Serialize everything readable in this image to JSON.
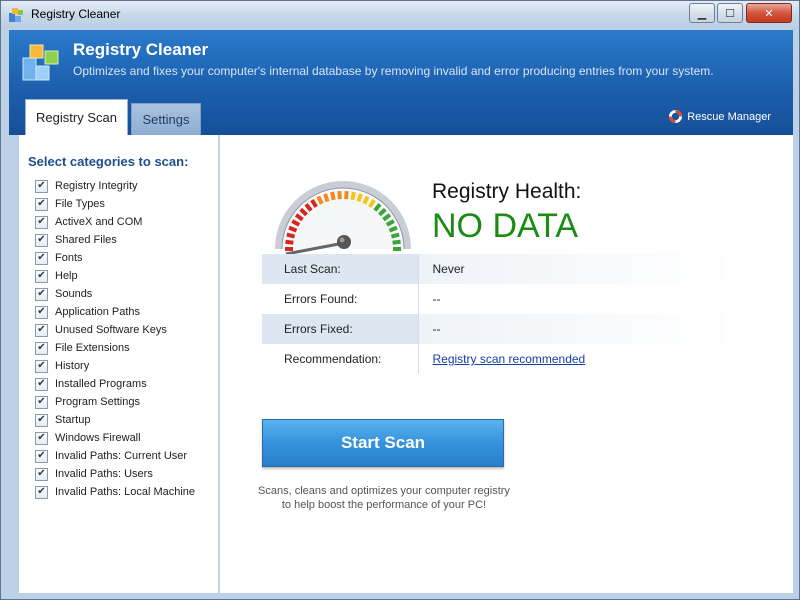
{
  "window": {
    "title": "Registry Cleaner",
    "controls": {
      "minimize": "▁",
      "maximize": "☐",
      "close": "✕"
    }
  },
  "header": {
    "title": "Registry Cleaner",
    "subtitle": "Optimizes and fixes your computer's internal database by removing invalid and error producing entries from your system.",
    "tabs": [
      {
        "label": "Registry Scan",
        "active": true
      },
      {
        "label": "Settings",
        "active": false
      }
    ],
    "rescue_manager": {
      "label": "Rescue Manager",
      "icon": "lifebuoy-icon"
    }
  },
  "categories": {
    "title": "Select categories to scan:",
    "items": [
      {
        "label": "Registry Integrity",
        "checked": true
      },
      {
        "label": "File Types",
        "checked": true
      },
      {
        "label": "ActiveX and COM",
        "checked": true
      },
      {
        "label": "Shared Files",
        "checked": true
      },
      {
        "label": "Fonts",
        "checked": true
      },
      {
        "label": "Help",
        "checked": true
      },
      {
        "label": "Sounds",
        "checked": true
      },
      {
        "label": "Application Paths",
        "checked": true
      },
      {
        "label": "Unused Software Keys",
        "checked": true
      },
      {
        "label": "File Extensions",
        "checked": true
      },
      {
        "label": "History",
        "checked": true
      },
      {
        "label": "Installed Programs",
        "checked": true
      },
      {
        "label": "Program Settings",
        "checked": true
      },
      {
        "label": "Startup",
        "checked": true
      },
      {
        "label": "Windows Firewall",
        "checked": true
      },
      {
        "label": "Invalid Paths: Current User",
        "checked": true
      },
      {
        "label": "Invalid Paths: Users",
        "checked": true
      },
      {
        "label": "Invalid Paths: Local Machine",
        "checked": true
      }
    ],
    "check_glyph": "✔"
  },
  "health": {
    "label": "Registry Health:",
    "value": "NO DATA",
    "value_color": "#1a8c14"
  },
  "info": {
    "rows": [
      {
        "key": "Last Scan:",
        "value": "Never",
        "shaded": true
      },
      {
        "key": "Errors Found:",
        "value": "--",
        "shaded": false
      },
      {
        "key": "Errors Fixed:",
        "value": "--",
        "shaded": true
      },
      {
        "key": "Recommendation:",
        "value": "Registry scan recommended",
        "shaded": false,
        "link": true
      }
    ]
  },
  "action": {
    "start_label": "Start Scan",
    "description_line1": "Scans, cleans and optimizes your computer registry",
    "description_line2": "to help boost the performance of your PC!"
  },
  "colors": {
    "header_blue": "#1c5fae",
    "start_button": "#3592dc",
    "link": "#1540a8"
  }
}
